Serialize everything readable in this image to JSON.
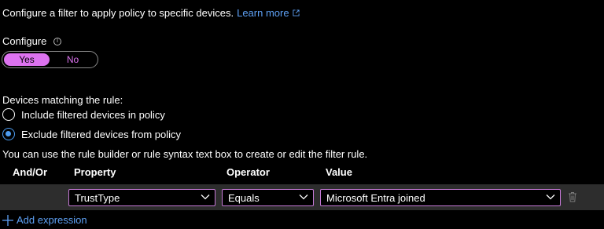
{
  "intro": {
    "text": "Configure a filter to apply policy to specific devices.",
    "link_text": "Learn more",
    "link_icon": "external-link-icon"
  },
  "configure": {
    "label": "Configure",
    "info_icon": "info-icon",
    "toggle": {
      "yes_label": "Yes",
      "no_label": "No",
      "selected": "Yes"
    }
  },
  "devices": {
    "label": "Devices matching the rule:",
    "options": [
      {
        "label": "Include filtered devices in policy",
        "checked": false
      },
      {
        "label": "Exclude filtered devices from policy",
        "checked": true
      }
    ]
  },
  "hint": "You can use the rule builder or rule syntax text box to create or edit the filter rule.",
  "table": {
    "headers": {
      "andor": "And/Or",
      "property": "Property",
      "operator": "Operator",
      "value": "Value"
    },
    "row": {
      "property": "TrustType",
      "operator": "Equals",
      "value": "Microsoft Entra joined"
    }
  },
  "add_expression": "Add expression",
  "colors": {
    "accent": "#dd73f0",
    "link": "#5ea1f5",
    "radio": "#4d9cf0",
    "row_bg": "#2d2d2d"
  }
}
